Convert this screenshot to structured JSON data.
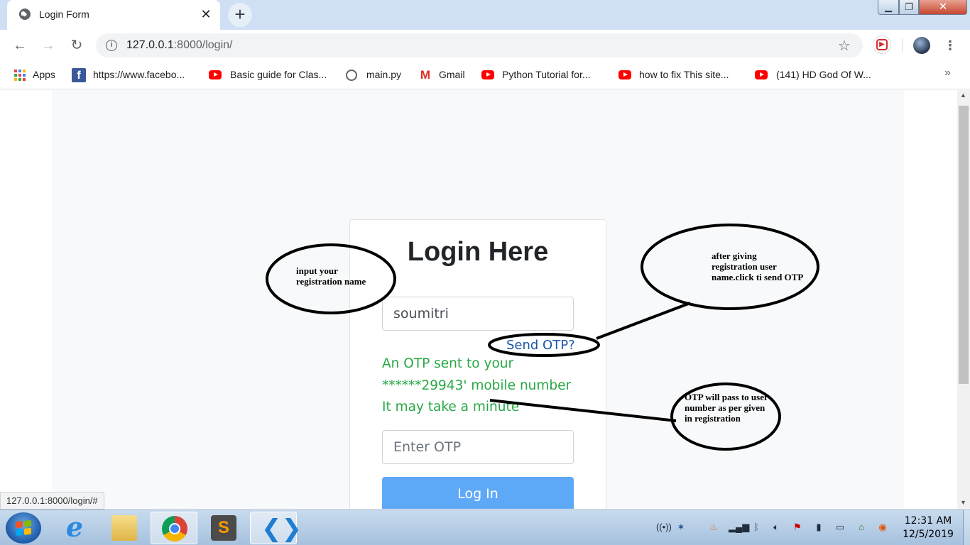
{
  "browser": {
    "tab_title": "Login Form",
    "tab_close": "✕",
    "new_tab": "+",
    "url_host": "127.0.0.1",
    "url_rest": ":8000/login/",
    "status_url": "127.0.0.1:8000/login/#"
  },
  "bookmarks": [
    {
      "label": "Apps",
      "icon": "apps-icon"
    },
    {
      "label": "https://www.facebo...",
      "icon": "facebook-icon"
    },
    {
      "label": "Basic guide for Clas...",
      "icon": "youtube-icon"
    },
    {
      "label": "main.py",
      "icon": "globe-icon"
    },
    {
      "label": "Gmail",
      "icon": "gmail-icon"
    },
    {
      "label": "Python Tutorial for...",
      "icon": "youtube-icon"
    },
    {
      "label": "how to fix This site...",
      "icon": "youtube-icon"
    },
    {
      "label": "(141) HD God Of W...",
      "icon": "youtube-icon"
    }
  ],
  "form": {
    "title": "Login Here",
    "username_value": "soumitri",
    "send_otp_link": "Send OTP?",
    "otp_message": "An OTP sent to your ******29943' mobile number It may take a minute",
    "otp_placeholder": "Enter OTP",
    "login_button": "Log In"
  },
  "annotations": {
    "username_note": "input your registration name",
    "send_otp_note": "after giving registration user name.click ti send OTP",
    "otp_note": "OTP will pass to user number as per given in registration"
  },
  "taskbar": {
    "clock_time": "12:31 AM",
    "clock_date": "12/5/2019"
  },
  "colors": {
    "accent": "#5ea9f7",
    "success": "#28a745",
    "link": "#1a57a8"
  }
}
